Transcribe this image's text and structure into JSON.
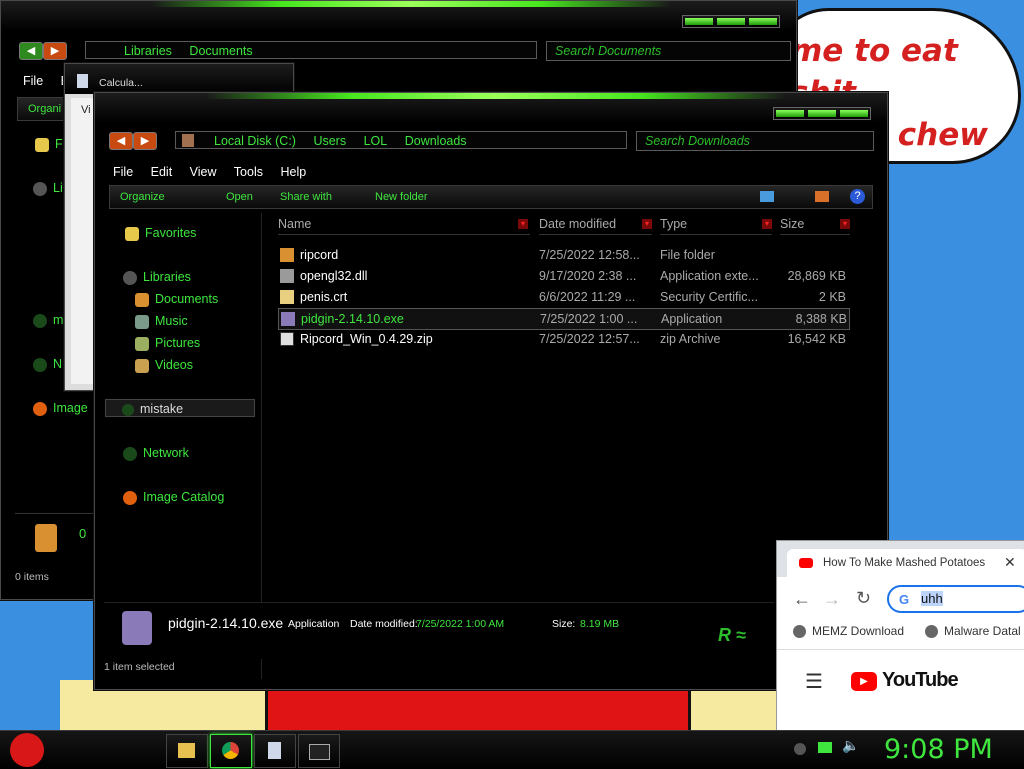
{
  "wallpaper": {
    "bubble_line1": "me to eat shit",
    "bubble_line2": "e and chew"
  },
  "back_window": {
    "address": [
      "Libraries",
      "Documents"
    ],
    "search_placeholder": "Search Documents",
    "menu": [
      "File",
      "E"
    ],
    "toolbar_label": "Organi",
    "nav_fragments": [
      "F",
      "Li",
      "m",
      "N",
      "Image"
    ],
    "count": "0",
    "status": "0 items"
  },
  "calc_window": {
    "title": "Calcula...",
    "label": "Vi"
  },
  "main_window": {
    "address": [
      "Local Disk (C:)",
      "Users",
      "LOL",
      "Downloads"
    ],
    "search_placeholder": "Search Downloads",
    "menu": [
      "File",
      "Edit",
      "View",
      "Tools",
      "Help"
    ],
    "toolbar": [
      "Organize",
      "Open",
      "Share with",
      "New folder"
    ],
    "nav": {
      "favorites": "Favorites",
      "libraries": "Libraries",
      "documents": "Documents",
      "music": "Music",
      "pictures": "Pictures",
      "videos": "Videos",
      "mistake": "mistake",
      "network": "Network",
      "image_catalog": "Image Catalog"
    },
    "columns": [
      "Name",
      "Date modified",
      "Type",
      "Size"
    ],
    "files": [
      {
        "name": "ripcord",
        "date": "7/25/2022 12:58...",
        "type": "File folder",
        "size": ""
      },
      {
        "name": "opengl32.dll",
        "date": "9/17/2020 2:38 ...",
        "type": "Application exte...",
        "size": "28,869 KB"
      },
      {
        "name": "penis.crt",
        "date": "6/6/2022 11:29 ...",
        "type": "Security Certific...",
        "size": "2 KB"
      },
      {
        "name": "pidgin-2.14.10.exe",
        "date": "7/25/2022 1:00 ...",
        "type": "Application",
        "size": "8,388 KB"
      },
      {
        "name": "Ripcord_Win_0.4.29.zip",
        "date": "7/25/2022 12:57...",
        "type": "zip Archive",
        "size": "16,542 KB"
      }
    ],
    "details": {
      "name": "pidgin-2.14.10.exe",
      "type": "Application",
      "date_label": "Date modified:",
      "date_value": "7/25/2022 1:00 AM",
      "size_label": "Size:",
      "size_value": "8.19 MB"
    },
    "status": "1 item selected"
  },
  "chrome": {
    "tab_title": "How To Make Mashed Potatoes",
    "omnibox": "uhh",
    "bookmarks": [
      "MEMZ Download",
      "Malware Datal"
    ],
    "logo_text": "YouTube"
  },
  "taskbar": {
    "clock": "9:08 PM"
  },
  "colors": {
    "accent_green": "#3ee63e",
    "bg_black": "#000000",
    "wallpaper_blue": "#3a8fe0"
  }
}
